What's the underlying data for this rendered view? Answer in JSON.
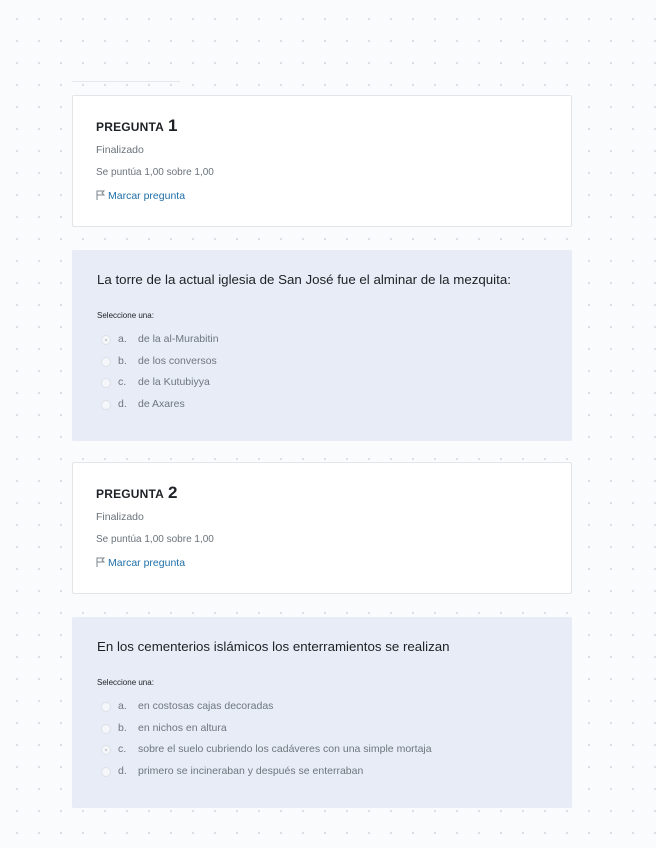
{
  "questions": [
    {
      "heading": "PREGUNTA",
      "number": "1",
      "state": "Finalizado",
      "grade": "Se puntúa 1,00 sobre 1,00",
      "flag_label": "Marcar pregunta",
      "text": "La torre de la actual iglesia de San José fue el alminar de la mezquita:",
      "prompt": "Seleccione una:",
      "answers": [
        {
          "letter": "a.",
          "text": "de la al-Murabitin",
          "selected": true
        },
        {
          "letter": "b.",
          "text": "de los conversos",
          "selected": false
        },
        {
          "letter": "c.",
          "text": "de la Kutubiyya",
          "selected": false
        },
        {
          "letter": "d.",
          "text": "de Axares",
          "selected": false
        }
      ]
    },
    {
      "heading": "PREGUNTA",
      "number": "2",
      "state": "Finalizado",
      "grade": "Se puntúa 1,00 sobre 1,00",
      "flag_label": "Marcar pregunta",
      "text": "En los cementerios islámicos los enterramientos se realizan",
      "prompt": "Seleccione una:",
      "answers": [
        {
          "letter": "a.",
          "text": "en costosas cajas decoradas",
          "selected": false
        },
        {
          "letter": "b.",
          "text": "en nichos en altura",
          "selected": false
        },
        {
          "letter": "c.",
          "text": "sobre el suelo cubriendo los cadáveres con una simple mortaja",
          "selected": true
        },
        {
          "letter": "d.",
          "text": "primero se incineraban y después se enterraban",
          "selected": false
        }
      ]
    }
  ],
  "icons": {
    "flag": "flag-icon",
    "radio": "radio-icon"
  },
  "colors": {
    "link": "#1f6fa8",
    "content_bg": "#e7ecf6",
    "info_bg": "#ffffff"
  }
}
